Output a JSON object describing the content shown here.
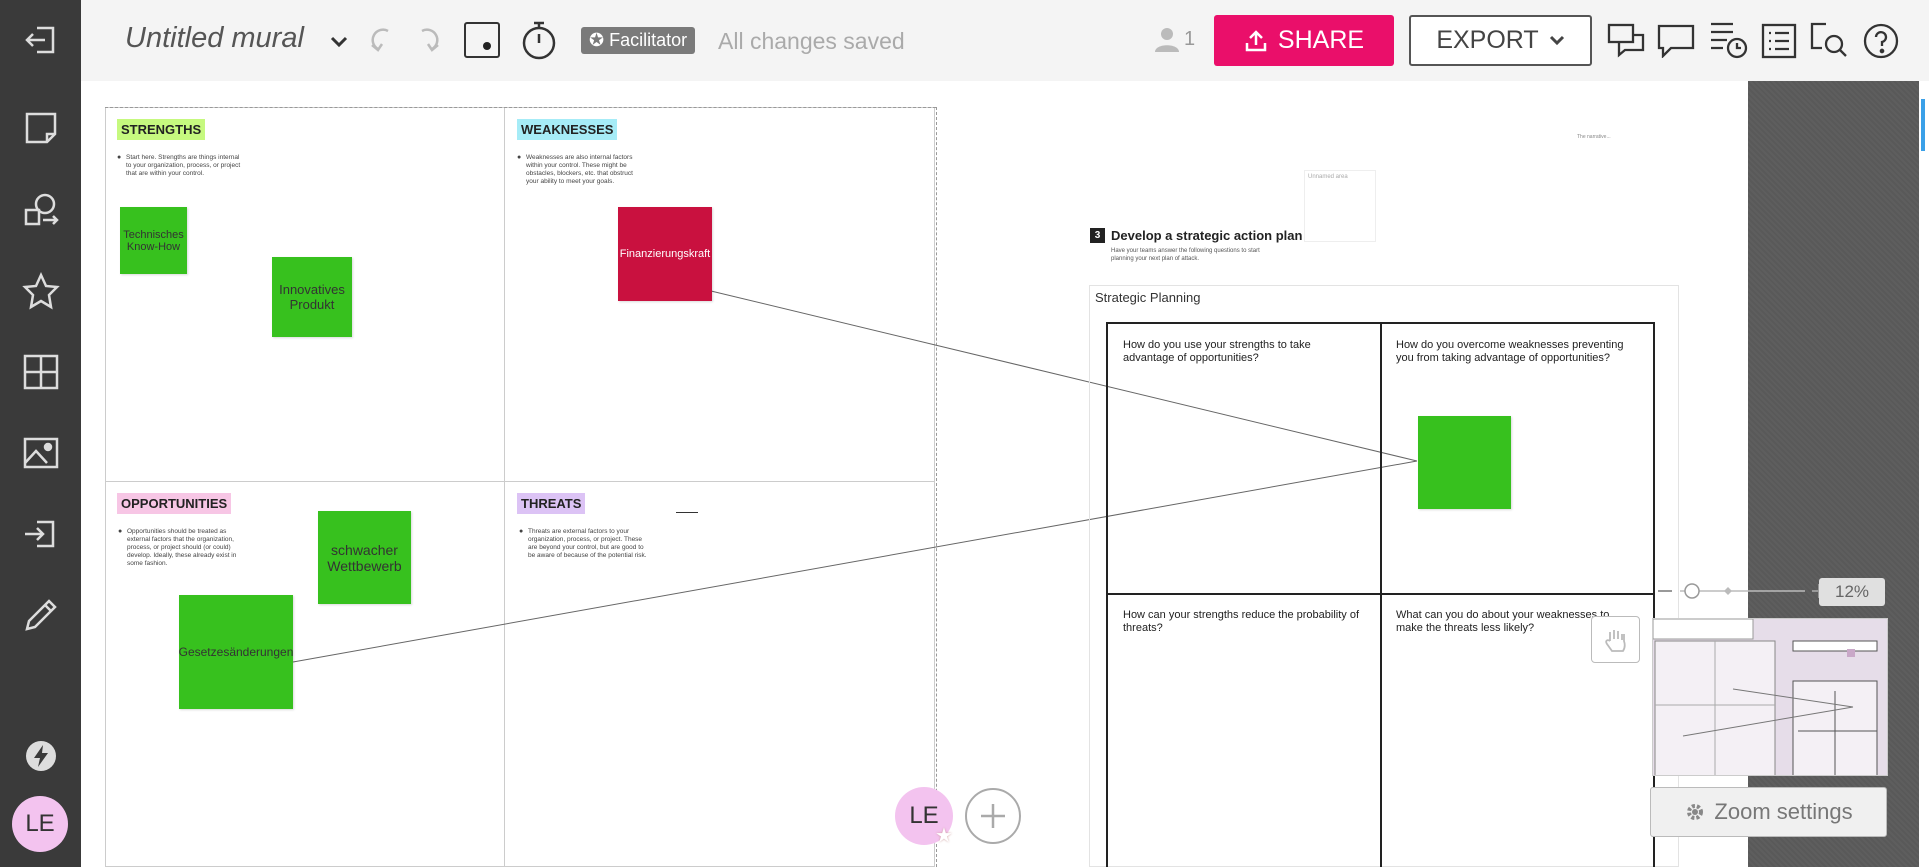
{
  "topbar": {
    "title": "Untitled mural",
    "facilitator_label": "Facilitator",
    "save_status": "All changes saved",
    "user_count": "1",
    "share_label": "SHARE",
    "export_label": "EXPORT"
  },
  "sidebar": {
    "avatar_initials": "LE"
  },
  "swot": {
    "strengths": {
      "label": "STRENGTHS",
      "color": "#c6f97f",
      "desc": "Start here. Strengths are things internal to your organization, process, or project that are within your control."
    },
    "weaknesses": {
      "label": "WEAKNESSES",
      "color": "#a6ecf7",
      "desc": "Weaknesses are also internal factors within your control. These might be obstacles, blockers, etc. that obstruct your ability to meet your goals."
    },
    "opportunities": {
      "label": "OPPORTUNITIES",
      "color": "#f7c6e5",
      "desc": "Opportunities should be treated as external factors that the organization, process, or project should (or could) develop. Ideally, these already exist in some fashion."
    },
    "threats": {
      "label": "THREATS",
      "color": "#dcc3f5",
      "desc": "Threats are external factors to your organization, process, or project. These are beyond your control, but are good to be aware of because of the potential risk."
    }
  },
  "notes": {
    "n1": "Technisches Know-How",
    "n2": "Innovatives Produkt",
    "n3": "Finanzierungskraft",
    "n4": "schwacher Wettbewerb",
    "n5": "Gesetzesänderungen",
    "green": "#37c11e",
    "red": "#c9113f"
  },
  "plan": {
    "step_number": "3",
    "step_title": "Develop a strategic action plan",
    "step_desc": "Have your teams answer the following questions to start planning your next plan of attack.",
    "frame_title": "Strategic Planning",
    "unnamed_area": "Unnamed area",
    "tiny_text": "The narrative...",
    "q1": "How do you use your strengths to take advantage of opportunities?",
    "q2": "How do you overcome weaknesses preventing you from taking advantage of opportunities?",
    "q3": "How can your strengths reduce the probability of threats?",
    "q4": "What can you do about your weaknesses to make the threats less likely?"
  },
  "zoom": {
    "percent": "12%",
    "settings_label": "Zoom settings"
  },
  "collab": {
    "initials": "LE"
  },
  "colors": {
    "accent": "#ea0f6a",
    "sidebar": "#3a3a3a"
  }
}
